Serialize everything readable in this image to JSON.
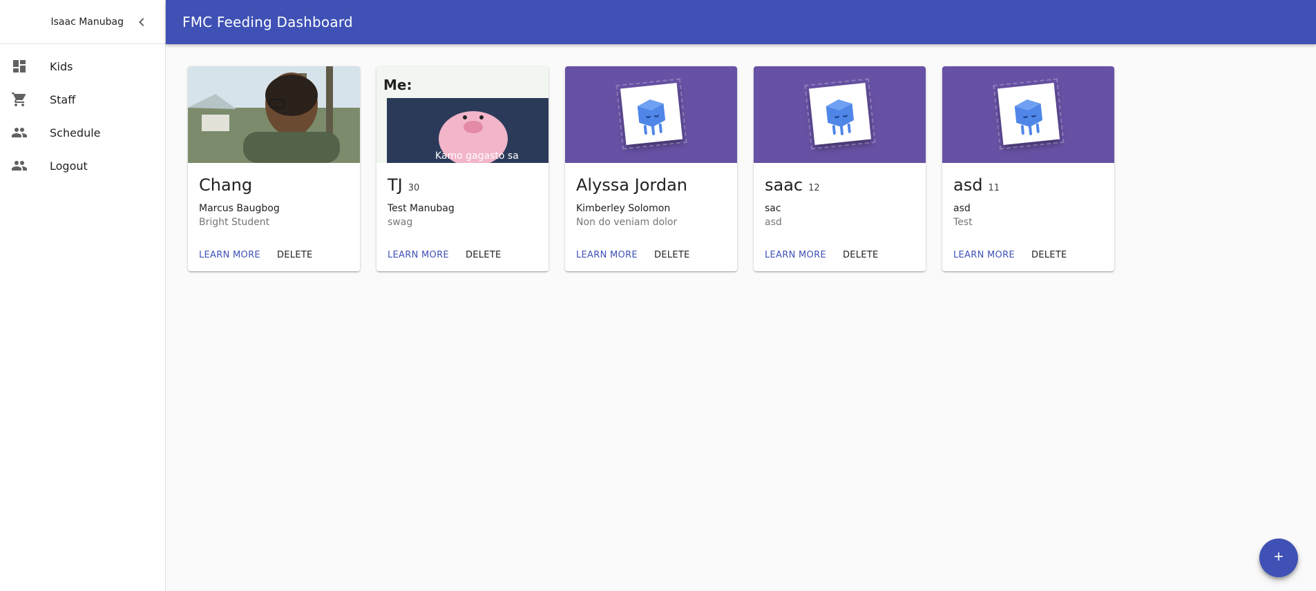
{
  "app": {
    "title": "FMC Feeding Dashboard"
  },
  "sidebar": {
    "user_name": "Isaac Manubag",
    "collapse_icon": "chevron-left-icon",
    "items": [
      {
        "label": "Kids",
        "icon": "dashboard-icon"
      },
      {
        "label": "Staff",
        "icon": "shopping-cart-icon"
      },
      {
        "label": "Schedule",
        "icon": "people-icon"
      },
      {
        "label": "Logout",
        "icon": "people-icon"
      }
    ]
  },
  "cards": [
    {
      "name": "Chang",
      "age": "",
      "subtitle": "Marcus Baugbog",
      "description": "Bright Student",
      "media": "photo",
      "learn_more": "LEARN MORE",
      "delete": "DELETE"
    },
    {
      "name": "TJ",
      "age": "30",
      "subtitle": "Test Manubag",
      "description": "swag",
      "media": "meme",
      "meme_top": "Me:",
      "meme_bottom": "Kamo gagasto sa",
      "learn_more": "LEARN MORE",
      "delete": "DELETE"
    },
    {
      "name": "Alyssa Jordan",
      "age": "",
      "subtitle": "Kimberley Solomon",
      "description": "Non do veniam dolor",
      "media": "placeholder",
      "learn_more": "LEARN MORE",
      "delete": "DELETE"
    },
    {
      "name": "saac",
      "age": "12",
      "subtitle": "sac",
      "description": "asd",
      "media": "placeholder",
      "learn_more": "LEARN MORE",
      "delete": "DELETE"
    },
    {
      "name": "asd",
      "age": "11",
      "subtitle": "asd",
      "description": "Test",
      "media": "placeholder",
      "learn_more": "LEARN MORE",
      "delete": "DELETE"
    }
  ],
  "fab": {
    "icon": "plus-icon"
  },
  "colors": {
    "primary": "#3f51b5",
    "placeholder_bg": "#6751a4",
    "robot": "#4f86e8"
  }
}
